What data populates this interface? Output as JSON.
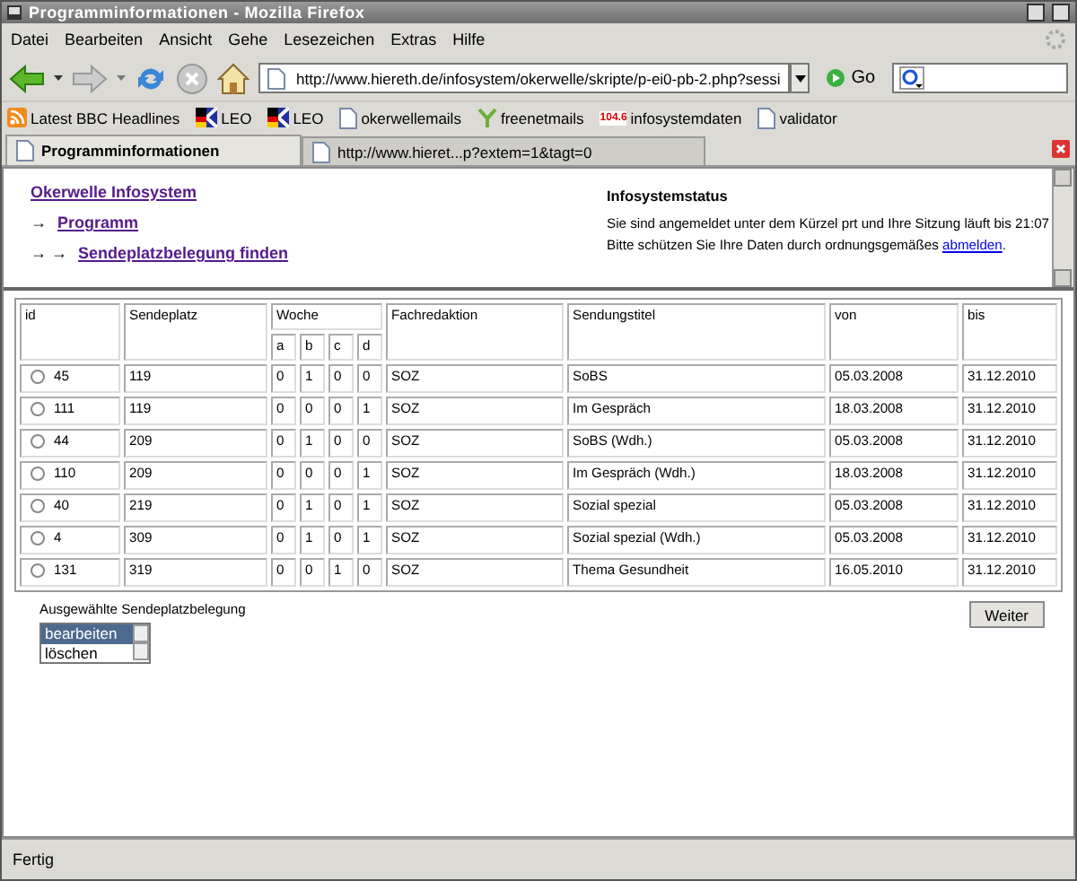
{
  "window": {
    "title": "Programminformationen - Mozilla Firefox"
  },
  "menu": [
    "Datei",
    "Bearbeiten",
    "Ansicht",
    "Gehe",
    "Lesezeichen",
    "Extras",
    "Hilfe"
  ],
  "navbar": {
    "url": "http://www.hiereth.de/infosystem/okerwelle/skripte/p-ei0-pb-2.php?sessi",
    "go": "Go"
  },
  "bookmarks": [
    {
      "label": "Latest BBC Headlines",
      "kind": "feed"
    },
    {
      "label": "LEO",
      "kind": "leo"
    },
    {
      "label": "LEO",
      "kind": "leo"
    },
    {
      "label": "okerwellemails",
      "kind": "page"
    },
    {
      "label": "freenetmails",
      "kind": "freenet"
    },
    {
      "label": "infosystemdaten",
      "kind": "radio"
    },
    {
      "label": "validator",
      "kind": "page"
    }
  ],
  "radio_badge": "104.6",
  "tabs": [
    {
      "label": "Programminformationen",
      "selected": true
    },
    {
      "label": "http://www.hieret...p?extem=1&tagt=0",
      "selected": false
    }
  ],
  "nav": {
    "home": "Okerwelle Infosystem",
    "items": [
      {
        "arrows": "→",
        "label": "Programm"
      },
      {
        "arrows": "→ →",
        "label": "Sendeplatzbelegung finden"
      }
    ]
  },
  "status_box": {
    "title": "Infosystemstatus",
    "line1": "Sie sind angemeldet unter dem Kürzel prt und Ihre Sitzung läuft bis 21:07",
    "line2": "Bitte schützen Sie Ihre Daten durch ordnungsgemäßes",
    "link": "abmelden",
    "end": "."
  },
  "table": {
    "columns": [
      "id",
      "Sendeplatz",
      "Woche",
      "Fachredaktion",
      "Sendungstitel",
      "von",
      "bis"
    ],
    "week_columns": [
      "a",
      "b",
      "c",
      "d"
    ],
    "rows": [
      {
        "id": "45",
        "selected": false,
        "sendeplatz": "119",
        "woche": [
          "0",
          "1",
          "0",
          "0"
        ],
        "fachredaktion": "SOZ",
        "titel": "SoBS",
        "von": "05.03.2008",
        "bis": "31.12.2010"
      },
      {
        "id": "111",
        "selected": false,
        "sendeplatz": "119",
        "woche": [
          "0",
          "0",
          "0",
          "1"
        ],
        "fachredaktion": "SOZ",
        "titel": "Im Gespräch",
        "von": "18.03.2008",
        "bis": "31.12.2010"
      },
      {
        "id": "44",
        "selected": false,
        "sendeplatz": "209",
        "woche": [
          "0",
          "1",
          "0",
          "0"
        ],
        "fachredaktion": "SOZ",
        "titel": "SoBS (Wdh.)",
        "von": "05.03.2008",
        "bis": "31.12.2010"
      },
      {
        "id": "110",
        "selected": false,
        "sendeplatz": "209",
        "woche": [
          "0",
          "0",
          "0",
          "1"
        ],
        "fachredaktion": "SOZ",
        "titel": "Im Gespräch (Wdh.)",
        "von": "18.03.2008",
        "bis": "31.12.2010"
      },
      {
        "id": "40",
        "selected": false,
        "sendeplatz": "219",
        "woche": [
          "0",
          "1",
          "0",
          "1"
        ],
        "fachredaktion": "SOZ",
        "titel": "Sozial spezial",
        "von": "05.03.2008",
        "bis": "31.12.2010"
      },
      {
        "id": "4",
        "selected": false,
        "sendeplatz": "309",
        "woche": [
          "0",
          "1",
          "0",
          "1"
        ],
        "fachredaktion": "SOZ",
        "titel": "Sozial spezial (Wdh.)",
        "von": "05.03.2008",
        "bis": "31.12.2010"
      },
      {
        "id": "131",
        "selected": false,
        "sendeplatz": "319",
        "woche": [
          "0",
          "0",
          "1",
          "0"
        ],
        "fachredaktion": "SOZ",
        "titel": "Thema Gesundheit",
        "von": "16.05.2010",
        "bis": "31.12.2010"
      }
    ]
  },
  "action": {
    "label": "Ausgewählte Sendeplatzbelegung",
    "options": [
      {
        "label": "bearbeiten",
        "selected": true
      },
      {
        "label": "löschen",
        "selected": false
      }
    ],
    "button": "Weiter"
  },
  "status_bar": "Fertig"
}
